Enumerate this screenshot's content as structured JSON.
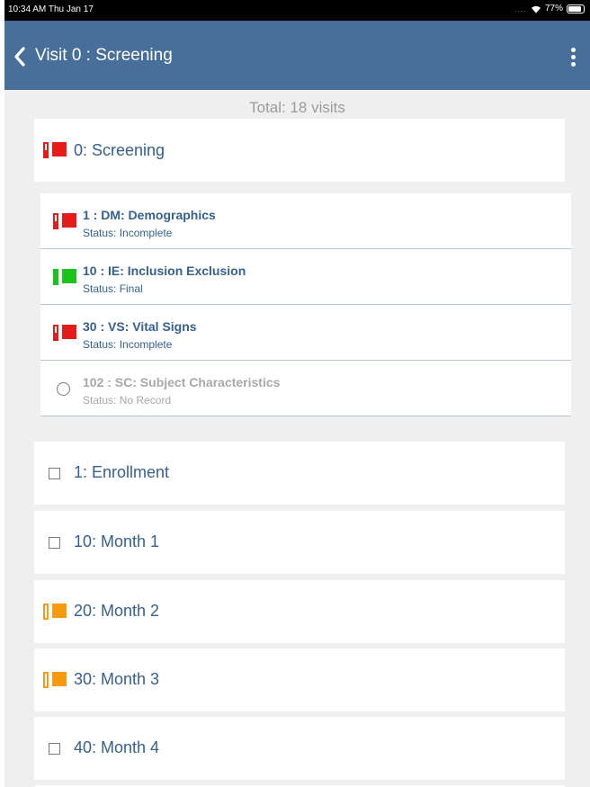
{
  "status_bar": {
    "time": "10:34 AM  Thu Jan 17",
    "signal_dots": "....",
    "battery": "77%",
    "battery_level": 0.77
  },
  "nav": {
    "back_icon": "chevron-left-icon",
    "title": "Visit 0 : Screening",
    "more_icon": "vertical-ellipsis-icon"
  },
  "total": "Total: 18 visits",
  "visits": [
    {
      "label": "0: Screening",
      "icon": "flag",
      "color": "#e81b1b"
    },
    {
      "label": "1: Enrollment",
      "icon": "checkbox",
      "color": "#7a7a7a"
    },
    {
      "label": "10: Month 1",
      "icon": "checkbox",
      "color": "#7a7a7a"
    },
    {
      "label": "20: Month 2",
      "icon": "flag",
      "color": "#f59a11"
    },
    {
      "label": "30: Month 3",
      "icon": "flag",
      "color": "#f59a11"
    },
    {
      "label": "40: Month 4",
      "icon": "checkbox",
      "color": "#7a7a7a"
    }
  ],
  "forms": [
    {
      "title": "1 : DM: Demographics",
      "status": "Status:  Incomplete",
      "icon": "flag-half",
      "color": "#e81b1b"
    },
    {
      "title": "10 : IE: Inclusion Exclusion",
      "status": "Status:  Final",
      "icon": "flag-full",
      "color": "#1cc41c"
    },
    {
      "title": "30 : VS: Vital Signs",
      "status": "Status:  Incomplete",
      "icon": "flag-half",
      "color": "#e81b1b"
    },
    {
      "title": "102 : SC: Subject Characteristics",
      "status": "Status:  No Record",
      "icon": "circle",
      "color": "#7a7a7a"
    }
  ],
  "colors": {
    "header": "#486e9a",
    "text": "#35608f",
    "background": "#efefef",
    "incomplete": "#e81b1b",
    "final": "#1cc41c",
    "partial": "#f59a11"
  }
}
